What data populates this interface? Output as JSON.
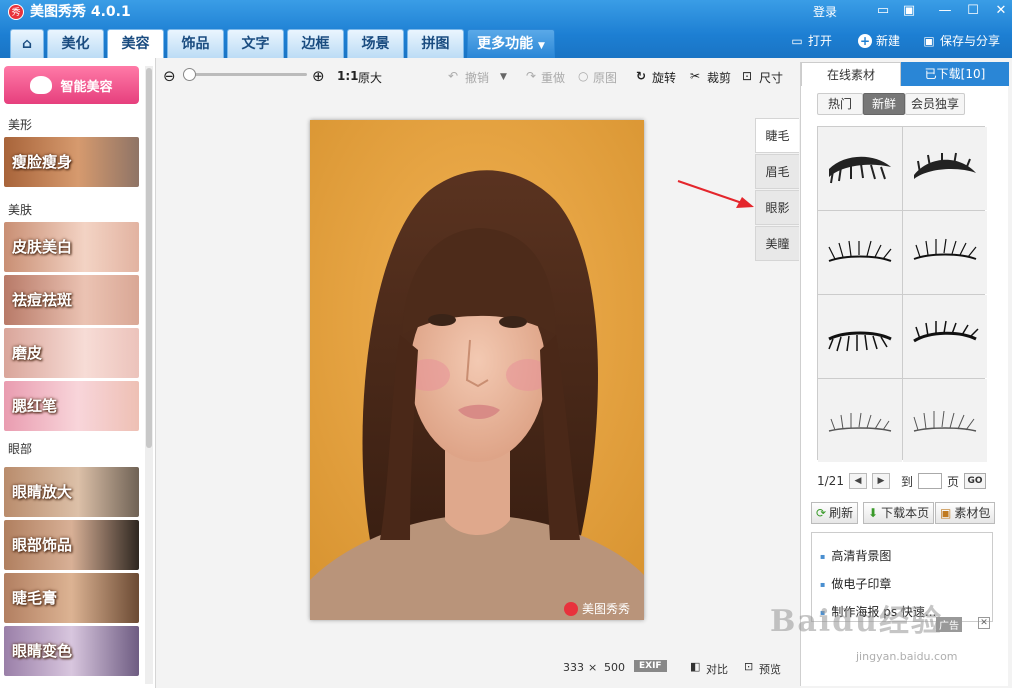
{
  "app": {
    "title": "美图秀秀 4.0.1",
    "logo_text": "秀",
    "login": "登录"
  },
  "tabs": [
    {
      "label": "美化"
    },
    {
      "label": "美容"
    },
    {
      "label": "饰品"
    },
    {
      "label": "文字"
    },
    {
      "label": "边框"
    },
    {
      "label": "场景"
    },
    {
      "label": "拼图"
    },
    {
      "label": "更多功能"
    }
  ],
  "top_actions": {
    "open": "打开",
    "new": "新建",
    "save": "保存与分享"
  },
  "sidebar": {
    "smart": "智能美容",
    "cat_shape": "美形",
    "cat_skin": "美肤",
    "cat_eye": "眼部",
    "items": [
      "瘦脸瘦身",
      "皮肤美白",
      "祛痘祛斑",
      "磨皮",
      "腮红笔",
      "眼睛放大",
      "眼部饰品",
      "睫毛膏",
      "眼睛变色"
    ]
  },
  "toolbar": {
    "ratio": "1:1",
    "original_size": "原大",
    "undo": "撤销",
    "redo": "重做",
    "original": "原图",
    "rotate": "旋转",
    "crop": "裁剪",
    "size": "尺寸"
  },
  "canvas": {
    "watermark": "美图秀秀"
  },
  "side_tabs": [
    "睫毛",
    "眉毛",
    "眼影",
    "美瞳"
  ],
  "right_panel": {
    "tab_online": "在线素材",
    "tab_downloaded": "已下载[10]",
    "sub_hot": "热门",
    "sub_fresh": "新鲜",
    "sub_member": "会员独享",
    "page": "1/21",
    "goto": "到",
    "page_unit": "页",
    "go": "GO",
    "refresh": "刷新",
    "download_page": "下载本页",
    "material_pack": "素材包",
    "links": [
      "高清背景图",
      "做电子印章",
      "制作海报 ps 快速..."
    ],
    "ad": "广告"
  },
  "status": {
    "width": "333",
    "times": "×",
    "height": "500",
    "exif": "EXIF",
    "compare": "对比",
    "preview": "预览"
  },
  "overlay": {
    "wm": "Baidu经验",
    "wm_url": "jingyan.baidu.com"
  }
}
